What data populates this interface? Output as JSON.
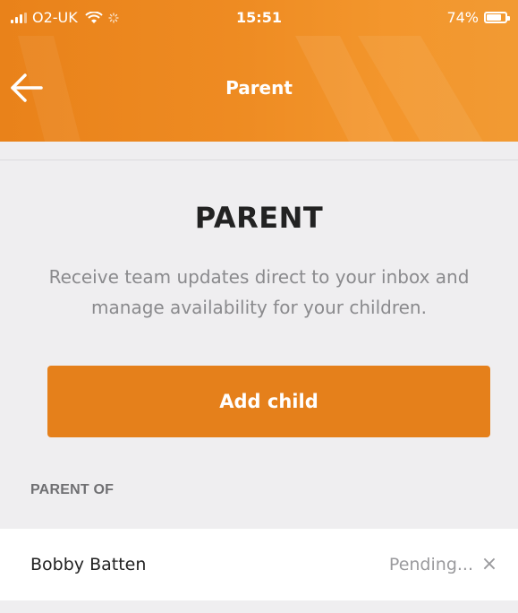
{
  "status_bar": {
    "carrier": "O2-UK",
    "time": "15:51",
    "battery": "74%"
  },
  "header": {
    "title": "Parent",
    "accent": "#ee8b22"
  },
  "main": {
    "title": "PARENT",
    "description": "Receive team updates direct to your inbox and manage availability for your children.",
    "add_child_label": "Add child",
    "button_color": "#e5801b"
  },
  "parent_of": {
    "header": "PARENT OF",
    "children": [
      {
        "name": "Bobby Batten",
        "status": "Pending...",
        "remove_glyph": "×"
      }
    ]
  }
}
